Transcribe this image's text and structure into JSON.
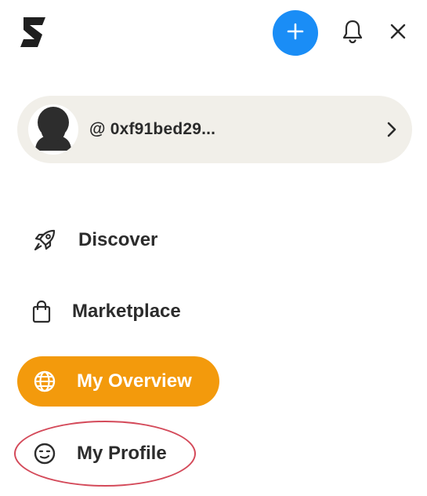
{
  "header": {
    "logo_icon": "s-logo-icon",
    "add_icon": "plus-icon",
    "notifications_icon": "bell-icon",
    "close_icon": "close-icon",
    "accent_color": "#1a8df6"
  },
  "profile": {
    "handle": "@ 0xf91bed29...",
    "avatar_icon": "avatar-silhouette-icon",
    "chevron_icon": "chevron-right-icon",
    "card_color": "#f1efe9"
  },
  "nav": {
    "items": [
      {
        "label": "Discover",
        "icon": "rocket-icon",
        "active": false
      },
      {
        "label": "Marketplace",
        "icon": "shopping-bag-icon",
        "active": false
      },
      {
        "label": "My Overview",
        "icon": "globe-icon",
        "active": true
      },
      {
        "label": "My Profile",
        "icon": "smiley-face-icon",
        "active": false
      }
    ],
    "active_color": "#f39a0c"
  },
  "annotation": {
    "highlight_color": "#d44a5a",
    "target": "My Profile"
  }
}
